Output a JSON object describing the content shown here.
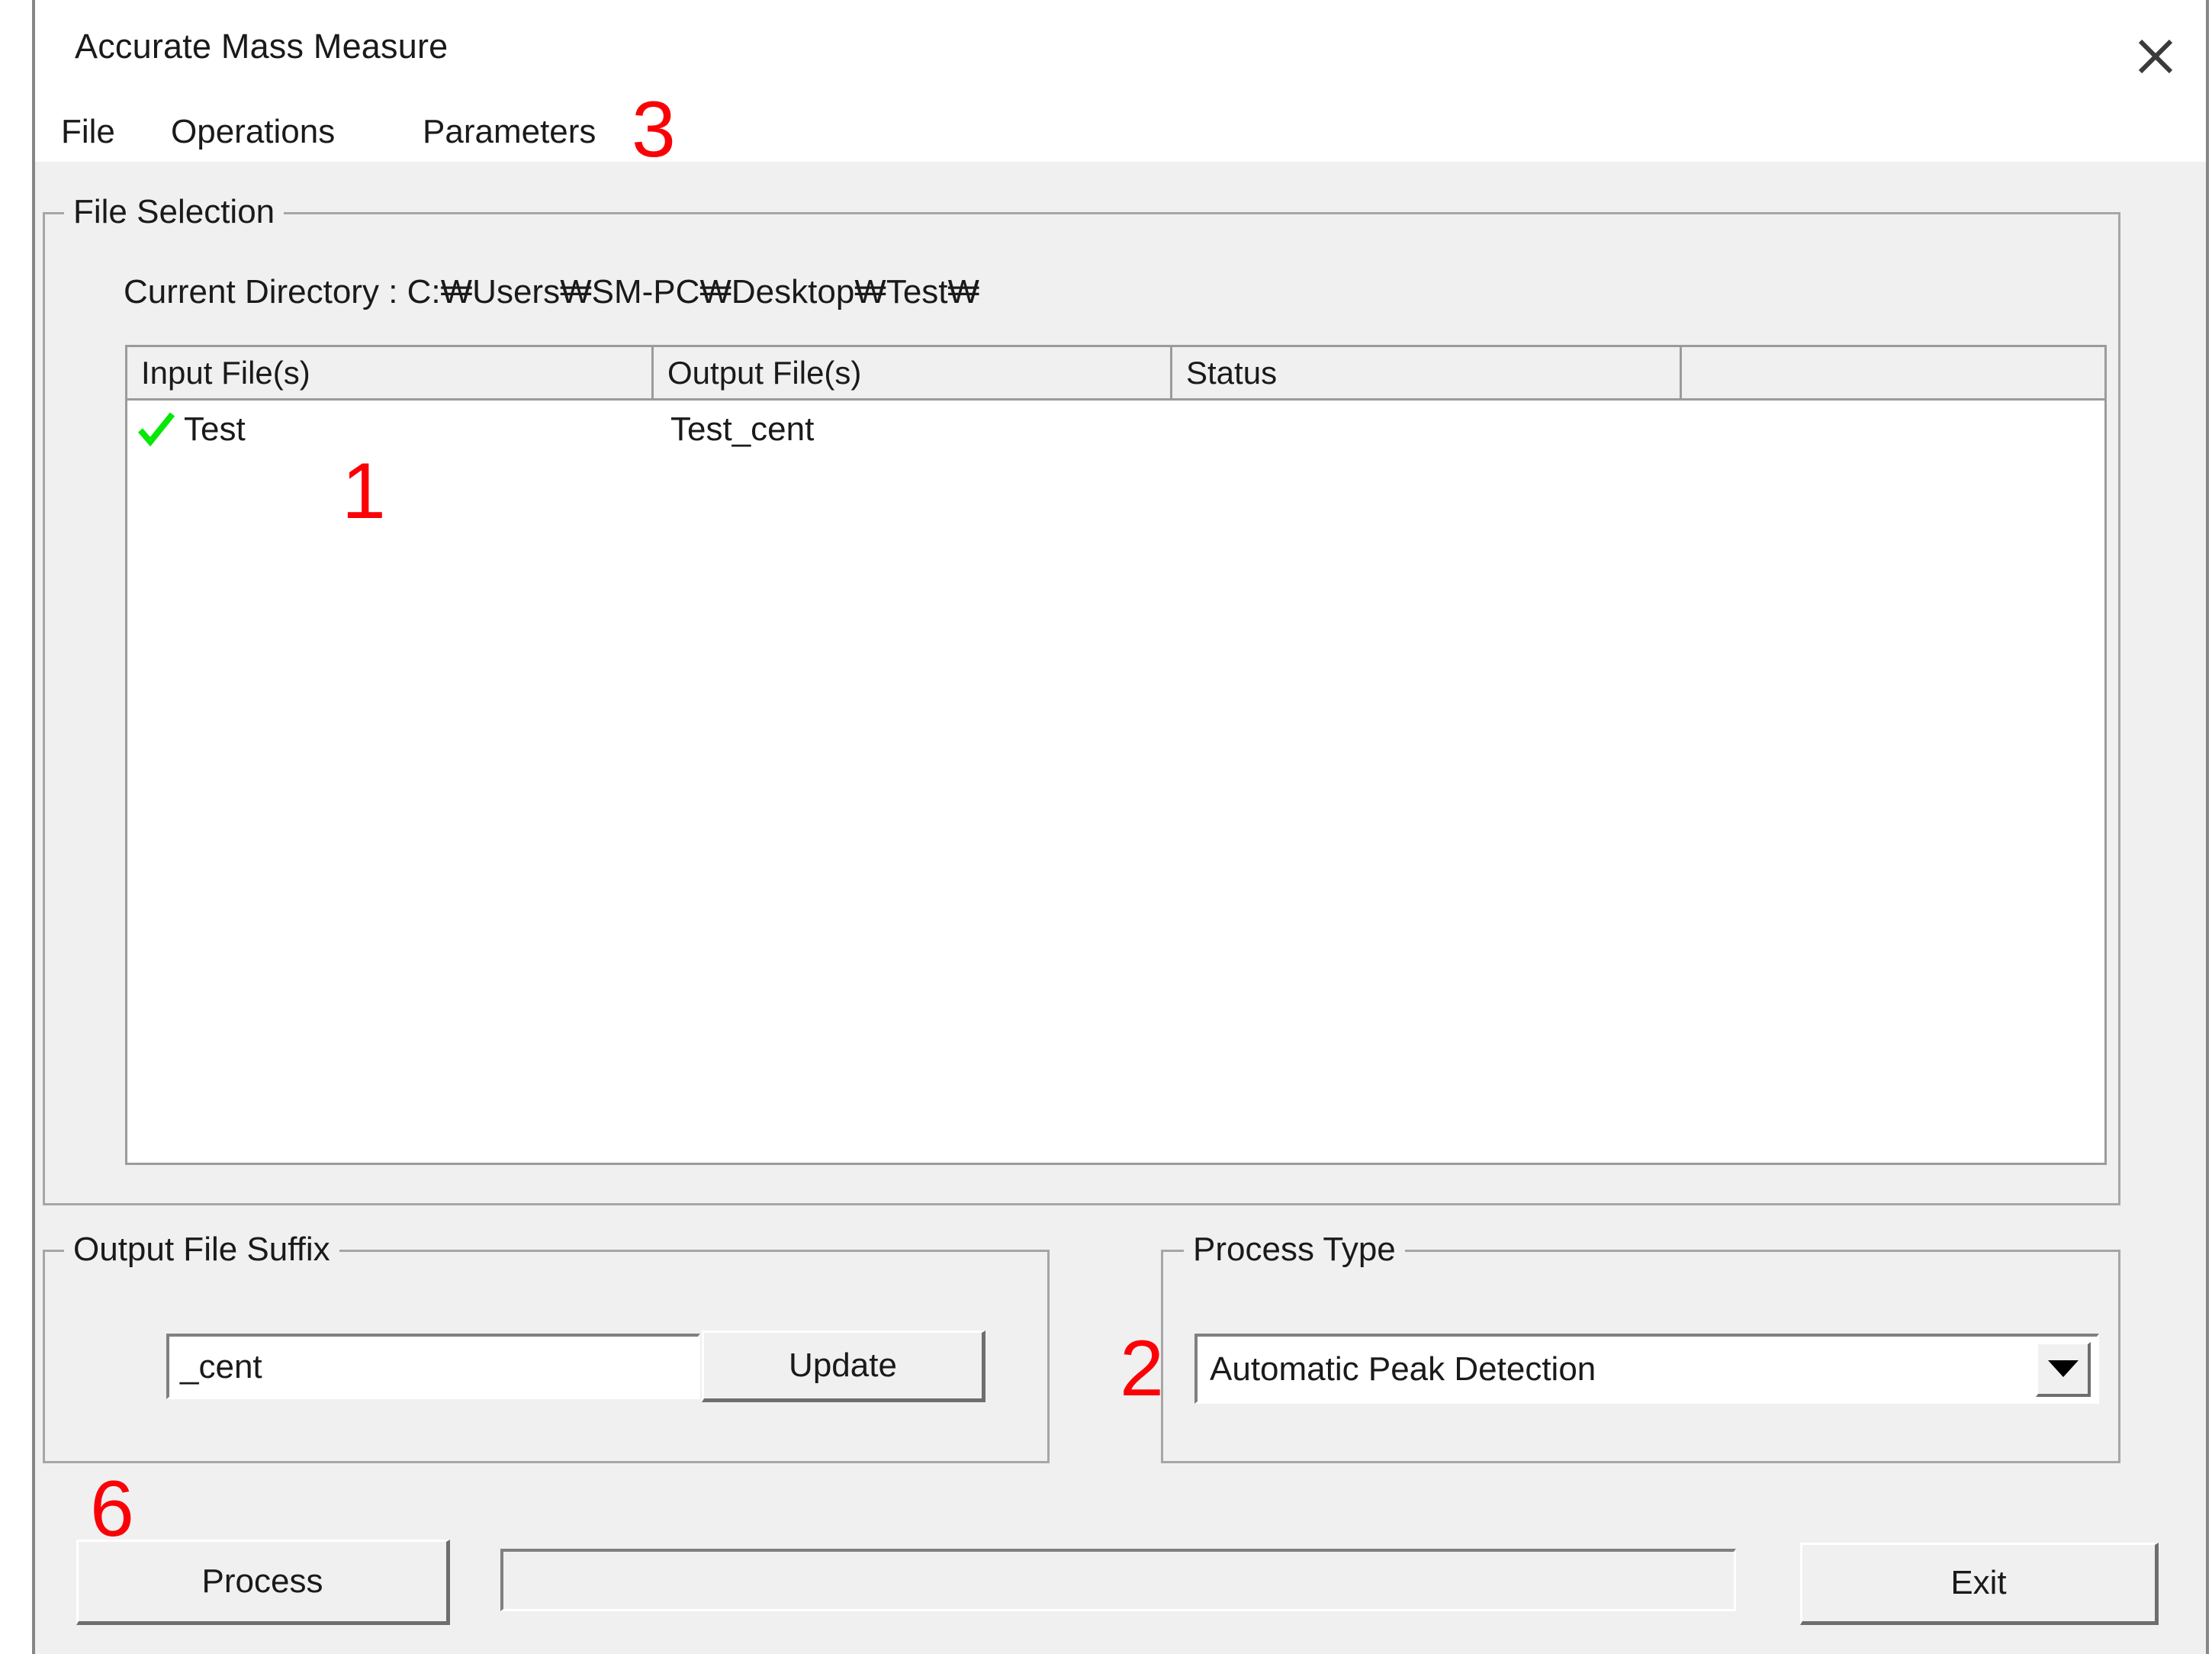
{
  "window": {
    "title": "Accurate Mass Measure",
    "close_icon": "close-icon"
  },
  "menubar": {
    "items": [
      {
        "label": "File"
      },
      {
        "label": "Operations"
      },
      {
        "label": "Parameters"
      }
    ]
  },
  "file_selection": {
    "legend": "File Selection",
    "current_directory_label": "Current Directory : C:₩Users₩SM-PC₩Desktop₩Test₩",
    "table": {
      "columns": [
        "Input File(s)",
        "Output File(s)",
        "Status",
        ""
      ],
      "rows": [
        {
          "status_icon": "green-check-icon",
          "input_file": "Test",
          "output_file": "Test_cent",
          "status": "",
          "extra": ""
        }
      ]
    }
  },
  "output_file_suffix": {
    "legend": "Output File Suffix",
    "suffix_value": "_cent",
    "suffix_placeholder": "",
    "update_label": "Update"
  },
  "process_type": {
    "legend": "Process Type",
    "selected": "Automatic Peak Detection",
    "dropdown_icon": "chevron-down-icon"
  },
  "footer": {
    "process_label": "Process",
    "exit_label": "Exit",
    "progress_percent": 0
  },
  "annotations": [
    {
      "id": "3",
      "text": "3"
    },
    {
      "id": "1",
      "text": "1"
    },
    {
      "id": "2",
      "text": "2"
    },
    {
      "id": "6",
      "text": "6"
    }
  ],
  "colors": {
    "annotation_red": "#fb0007",
    "check_green": "#06e805",
    "window_bg": "#f0f0f0",
    "field_bg": "#ffffff"
  }
}
